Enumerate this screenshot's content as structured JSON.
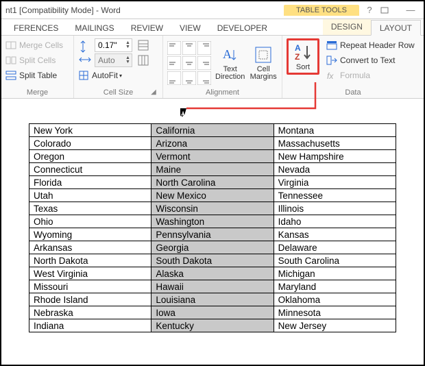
{
  "window": {
    "title": "nt1 [Compatibility Mode] - Word",
    "context_title": "TABLE TOOLS"
  },
  "tabs": {
    "references": "FERENCES",
    "mailings": "MAILINGS",
    "review": "REVIEW",
    "view": "VIEW",
    "developer": "DEVELOPER",
    "design": "DESIGN",
    "layout": "LAYOUT"
  },
  "ribbon": {
    "merge": {
      "label": "Merge",
      "merge_cells": "Merge Cells",
      "split_cells": "Split Cells",
      "split_table": "Split Table"
    },
    "cellsize": {
      "label": "Cell Size",
      "height_value": "0.17\"",
      "width_value": "",
      "auto_label": "Auto",
      "autofit_label": "AutoFit"
    },
    "alignment": {
      "label": "Alignment",
      "text_direction": "Text Direction",
      "cell_margins": "Cell Margins"
    },
    "data": {
      "label": "Data",
      "sort": "Sort",
      "repeat_header": "Repeat Header Row",
      "convert_text": "Convert to Text",
      "formula": "Formula"
    }
  },
  "table": {
    "rows": [
      [
        "New York",
        "California",
        "Montana"
      ],
      [
        "Colorado",
        "Arizona",
        "Massachusetts"
      ],
      [
        "Oregon",
        "Vermont",
        "New Hampshire"
      ],
      [
        "Connecticut",
        "Maine",
        "Nevada"
      ],
      [
        "Florida",
        "North Carolina",
        "Virginia"
      ],
      [
        "Utah",
        "New Mexico",
        "Tennessee"
      ],
      [
        "Texas",
        "Wisconsin",
        "Illinois"
      ],
      [
        "Ohio",
        "Washington",
        "Idaho"
      ],
      [
        "Wyoming",
        "Pennsylvania",
        "Kansas"
      ],
      [
        "Arkansas",
        "Georgia",
        "Delaware"
      ],
      [
        "North Dakota",
        "South Dakota",
        "South Carolina"
      ],
      [
        "West Virginia",
        "Alaska",
        "Michigan"
      ],
      [
        "Missouri",
        "Hawaii",
        "Maryland"
      ],
      [
        "Rhode Island",
        "Louisiana",
        "Oklahoma"
      ],
      [
        "Nebraska",
        "Iowa",
        "Minnesota"
      ],
      [
        "Indiana",
        "Kentucky",
        "New Jersey"
      ]
    ],
    "selected_col": 1
  }
}
